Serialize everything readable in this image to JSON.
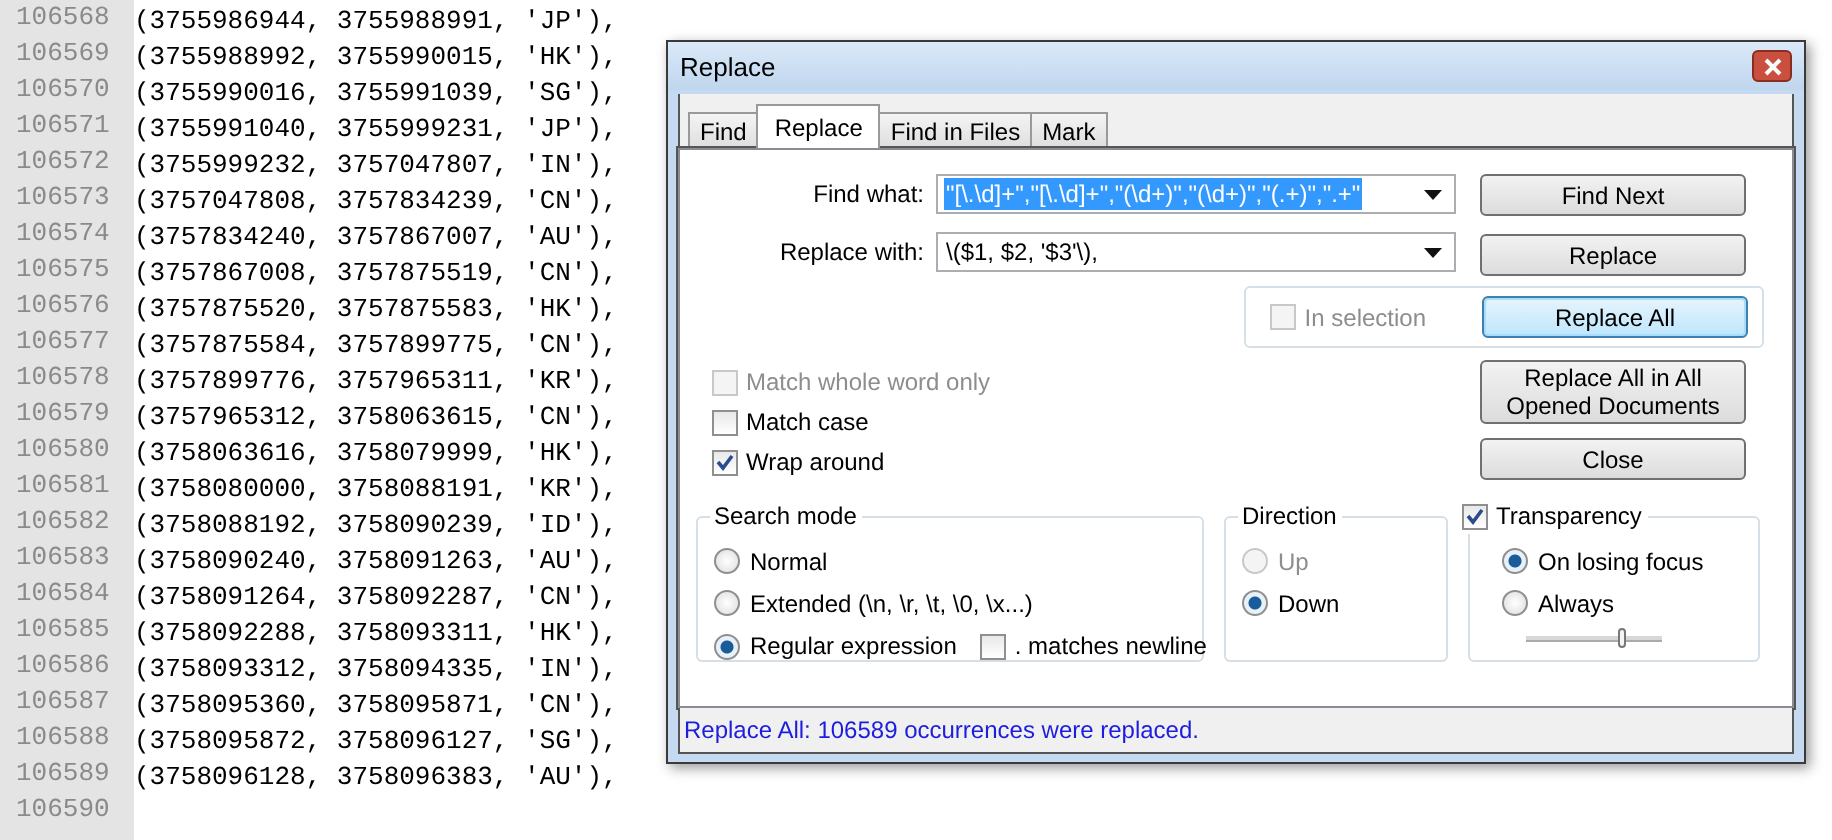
{
  "editor": {
    "lines": [
      {
        "number": "106568",
        "text": "(3755986944, 3755988991, 'JP'),"
      },
      {
        "number": "106569",
        "text": "(3755988992, 3755990015, 'HK'),"
      },
      {
        "number": "106570",
        "text": "(3755990016, 3755991039, 'SG'),"
      },
      {
        "number": "106571",
        "text": "(3755991040, 3755999231, 'JP'),"
      },
      {
        "number": "106572",
        "text": "(3755999232, 3757047807, 'IN'),"
      },
      {
        "number": "106573",
        "text": "(3757047808, 3757834239, 'CN'),"
      },
      {
        "number": "106574",
        "text": "(3757834240, 3757867007, 'AU'),"
      },
      {
        "number": "106575",
        "text": "(3757867008, 3757875519, 'CN'),"
      },
      {
        "number": "106576",
        "text": "(3757875520, 3757875583, 'HK'),"
      },
      {
        "number": "106577",
        "text": "(3757875584, 3757899775, 'CN'),"
      },
      {
        "number": "106578",
        "text": "(3757899776, 3757965311, 'KR'),"
      },
      {
        "number": "106579",
        "text": "(3757965312, 3758063615, 'CN'),"
      },
      {
        "number": "106580",
        "text": "(3758063616, 3758079999, 'HK'),"
      },
      {
        "number": "106581",
        "text": "(3758080000, 3758088191, 'KR'),"
      },
      {
        "number": "106582",
        "text": "(3758088192, 3758090239, 'ID'),"
      },
      {
        "number": "106583",
        "text": "(3758090240, 3758091263, 'AU'),"
      },
      {
        "number": "106584",
        "text": "(3758091264, 3758092287, 'CN'),"
      },
      {
        "number": "106585",
        "text": "(3758092288, 3758093311, 'HK'),"
      },
      {
        "number": "106586",
        "text": "(3758093312, 3758094335, 'IN'),"
      },
      {
        "number": "106587",
        "text": "(3758095360, 3758095871, 'CN'),"
      },
      {
        "number": "106588",
        "text": "(3758095872, 3758096127, 'SG'),"
      },
      {
        "number": "106589",
        "text": "(3758096128, 3758096383, 'AU'),"
      },
      {
        "number": "106590"
      }
    ]
  },
  "dialog": {
    "title": "Replace",
    "tabs": [
      {
        "label": "Find",
        "selected": false
      },
      {
        "label": "Replace",
        "selected": true
      },
      {
        "label": "Find in Files",
        "selected": false
      },
      {
        "label": "Mark",
        "selected": false
      }
    ],
    "fields": [
      {
        "label": "Find what:",
        "value": "\"[\\.\\d]+\",\"[\\.\\d]+\",\"(\\d+)\",\"(\\d+)\",\"(.+)\",\".+\"",
        "selected": true
      },
      {
        "label": "Replace with:",
        "value": "\\($1, $2, '$3'\\),",
        "selected": false
      }
    ],
    "in_selection": {
      "label": "In selection",
      "checked": false,
      "disabled": true
    },
    "buttons": [
      {
        "label": "Find Next",
        "focused": false
      },
      {
        "label": "Replace",
        "focused": false
      },
      {
        "label": "Replace All",
        "focused": true
      },
      {
        "label": "Replace All in All Opened Documents",
        "focused": false
      },
      {
        "label": "Close",
        "focused": false
      }
    ],
    "options": [
      {
        "label": "Match whole word only",
        "checked": false,
        "disabled": true
      },
      {
        "label": "Match case",
        "checked": false,
        "disabled": false
      },
      {
        "label": "Wrap around",
        "checked": true,
        "disabled": false
      }
    ],
    "search_mode": {
      "title": "Search mode",
      "options": [
        {
          "label": "Normal",
          "selected": false
        },
        {
          "label": "Extended (\\n, \\r, \\t, \\0, \\x...)",
          "selected": false
        },
        {
          "label": "Regular expression",
          "selected": true
        }
      ],
      "dot_newline": {
        "label": ". matches newline",
        "checked": false
      }
    },
    "direction": {
      "title": "Direction",
      "options": [
        {
          "label": "Up",
          "selected": false,
          "disabled": true
        },
        {
          "label": "Down",
          "selected": true,
          "disabled": false
        }
      ]
    },
    "transparency": {
      "label": "Transparency",
      "checked": true,
      "options": [
        {
          "label": "On losing focus",
          "selected": true
        },
        {
          "label": "Always",
          "selected": false
        }
      ],
      "level": 0.7
    },
    "status": "Replace All: 106589 occurrences were replaced."
  }
}
